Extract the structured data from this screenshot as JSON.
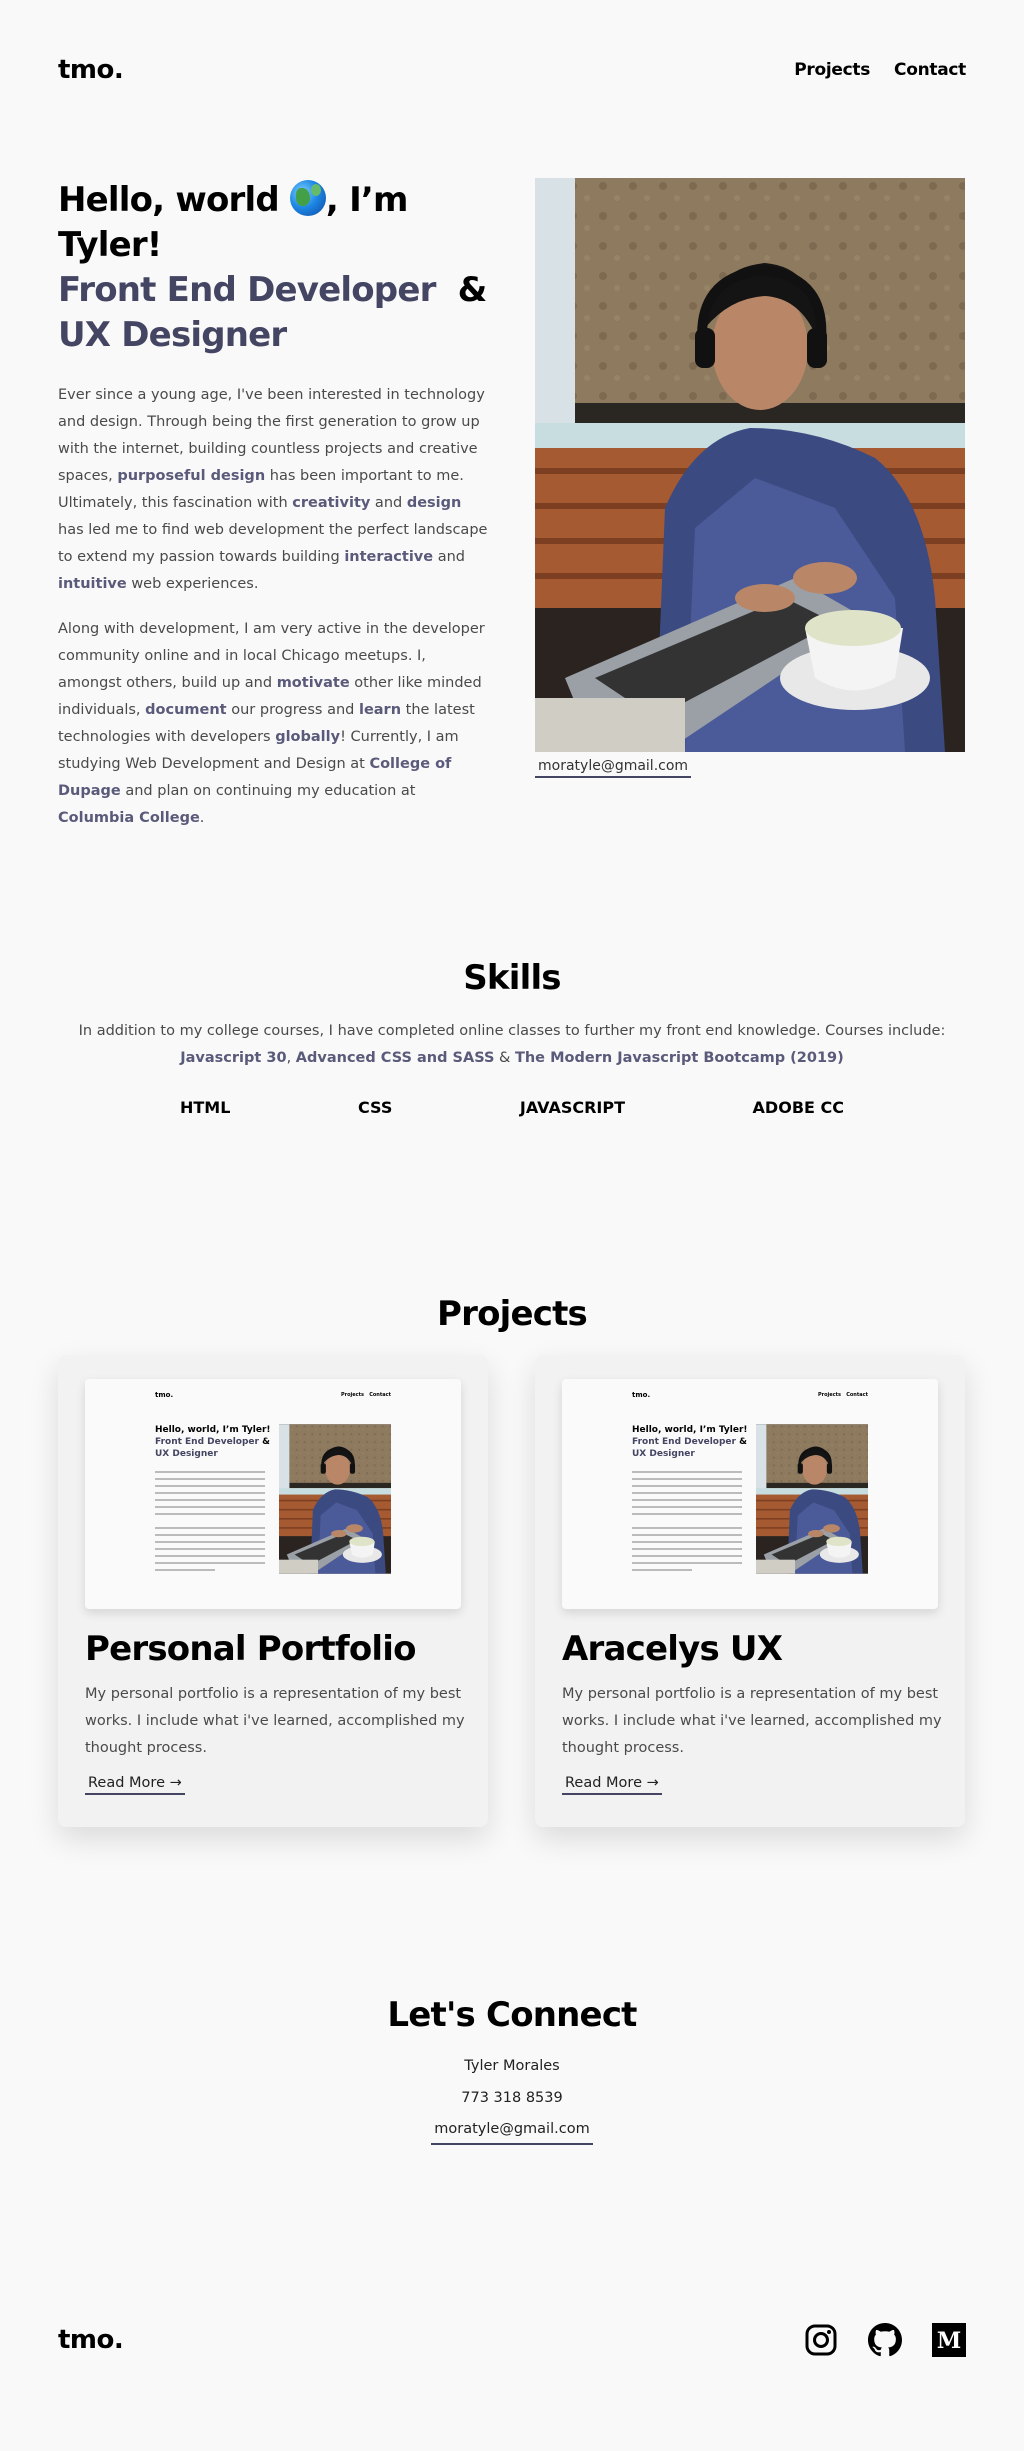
{
  "header": {
    "logo": "tmo.",
    "nav": [
      {
        "label": "Projects"
      },
      {
        "label": "Contact"
      }
    ]
  },
  "hero": {
    "greeting": "Hello, world",
    "greeting_suffix": ", I’m Tyler!",
    "role1": "Front End Developer",
    "amp": "&",
    "role2": "UX Designer",
    "email": "moratyle@gmail.com"
  },
  "bio": {
    "p1": [
      {
        "t": "Ever since a young age, I've been interested in technology and design. Through being the first generation to grow up with the internet, building countless projects and creative spaces, "
      },
      {
        "b": "purposeful design"
      },
      {
        "t": " has been important to me. Ultimately, this fascination with "
      },
      {
        "b": "creativity"
      },
      {
        "t": " and "
      },
      {
        "b": "design"
      },
      {
        "t": " has led me to find web development the perfect landscape to extend my passion towards building "
      },
      {
        "b": "interactive"
      },
      {
        "t": " and "
      },
      {
        "b": "intuitive"
      },
      {
        "t": " web experiences."
      }
    ],
    "p2": [
      {
        "t": "Along with development, I am very active in the developer community online and in local Chicago meetups. I, amongst others, build up and "
      },
      {
        "b": "motivate"
      },
      {
        "t": " other like minded individuals, "
      },
      {
        "b": "document"
      },
      {
        "t": " our progress and "
      },
      {
        "b": "learn"
      },
      {
        "t": " the latest technologies with developers "
      },
      {
        "b": "globally"
      },
      {
        "t": "! Currently, I am studying Web Development and Design at "
      },
      {
        "b": "College of Dupage"
      },
      {
        "t": " and plan on continuing my education at "
      },
      {
        "b": "Columbia College"
      },
      {
        "t": "."
      }
    ]
  },
  "skills": {
    "title": "Skills",
    "intro": "In addition to my college courses, I have completed online classes to further my front end knowledge. Courses include:",
    "course1": "Javascript 30",
    "sep1": ",",
    "course2": "Advanced CSS and SASS",
    "sep2": "&",
    "course3": "The Modern Javascript Bootcamp (2019)",
    "items": [
      "HTML",
      "CSS",
      "JAVASCRIPT",
      "ADOBE CC"
    ]
  },
  "projects": {
    "title": "Projects",
    "cards": [
      {
        "title": "Personal Portfolio",
        "text": "My personal portfolio is a representation of my best works. I include what i've learned, accomplished my thought process.",
        "link": "Read More"
      },
      {
        "title": "Aracelys UX",
        "text": "My personal portfolio is a representation of my best works. I include what i've learned, accomplished my thought process.",
        "link": "Read More"
      }
    ]
  },
  "connect": {
    "title": "Let's Connect",
    "name": "Tyler Morales",
    "phone": "773 318 8539",
    "email": "moratyle@gmail.com"
  },
  "footer": {
    "logo": "tmo.",
    "icons": [
      "instagram-icon",
      "github-icon",
      "medium-icon"
    ]
  },
  "colors": {
    "accent": "#444562",
    "background": "#f9f9f9",
    "text": "#4a4a4a"
  }
}
